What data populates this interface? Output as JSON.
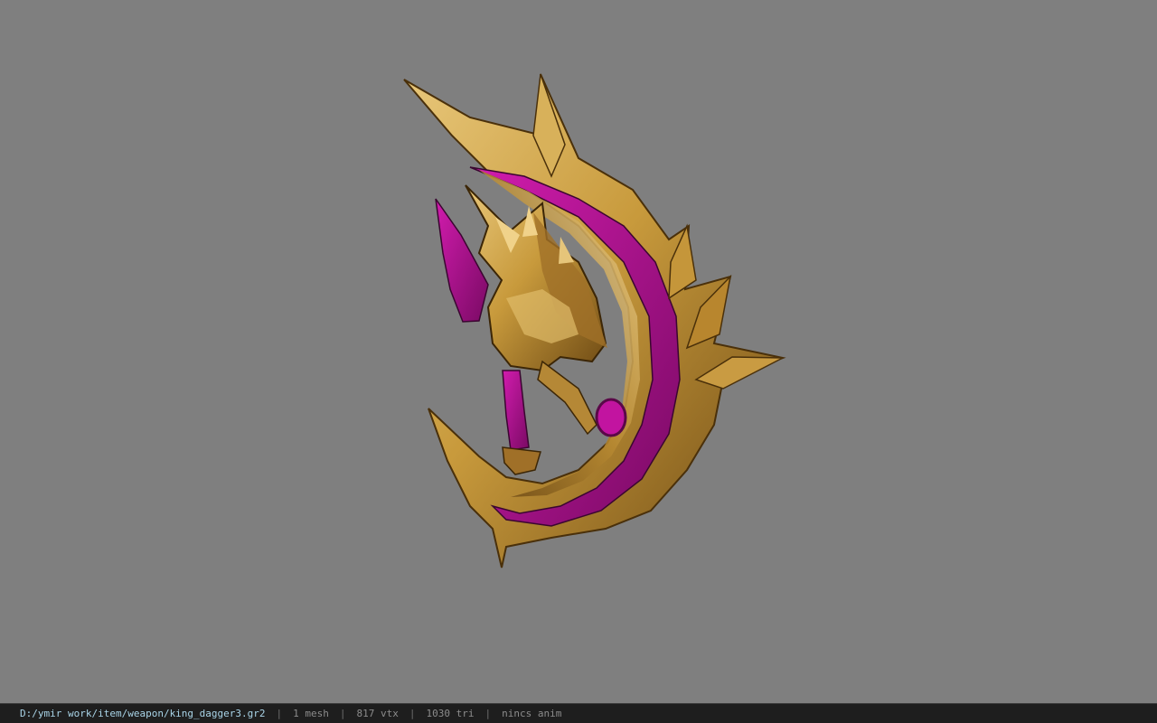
{
  "viewport": {
    "background": "#7f7f7f",
    "model_name": "king_dagger3"
  },
  "status_bar": {
    "file_path": "D:/ymir work/item/weapon/king_dagger3.gr2",
    "separator": "|",
    "mesh_count": "1 mesh",
    "vertex_count": "817 vtx",
    "triangle_count": "1030 tri",
    "anim_status": "nincs anim"
  },
  "colors": {
    "gold": "#c89a3c",
    "gold_dark": "#6e4a14",
    "magenta": "#b0128f",
    "status_bg": "#1e1e1e",
    "path_text": "#a9d4e8"
  }
}
